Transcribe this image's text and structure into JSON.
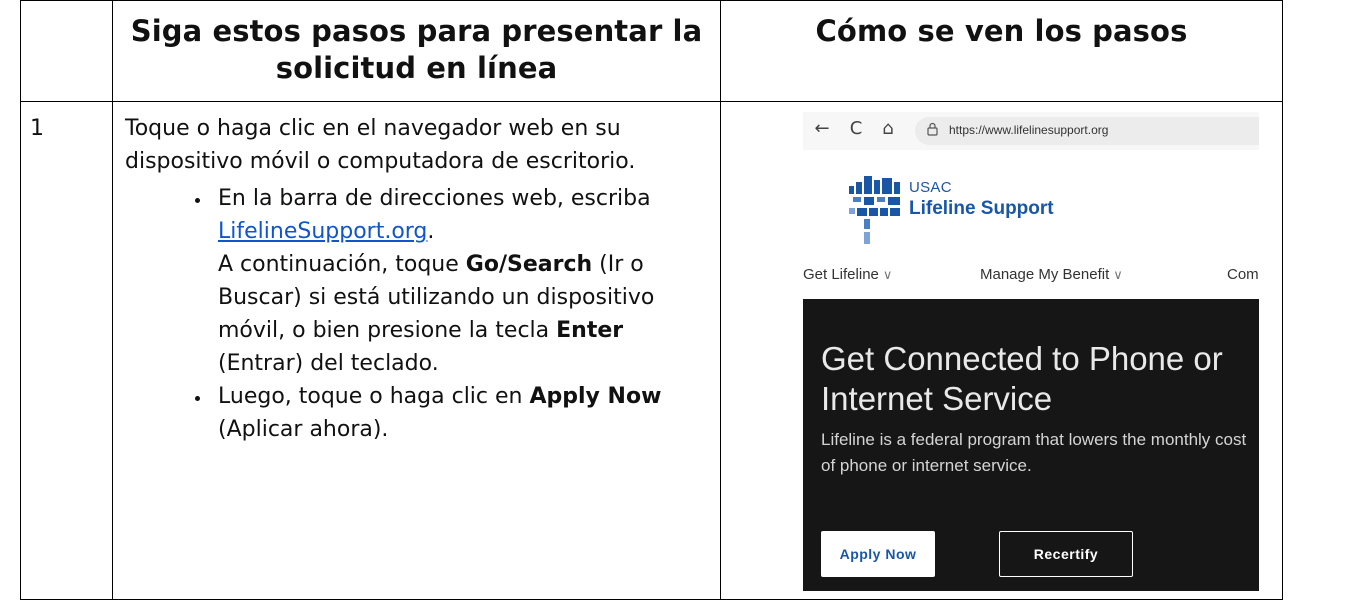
{
  "table": {
    "header_col2": "Siga estos pasos para presentar la solicitud en línea",
    "header_col3": "Cómo se ven los pasos"
  },
  "step1": {
    "number": "1",
    "intro": "Toque o haga clic en el navegador web en su dispositivo móvil o computadora de escritorio.",
    "bullet1": {
      "prefix": "En la barra de direcciones web, escriba ",
      "link": "LifelineSupport.org",
      "after_link": ".",
      "line2_pre": "A continuación, toque ",
      "go_search": "Go/Search",
      "line2_mid": " (Ir o Buscar) si está utilizando un dispositivo móvil, o bien presione la tecla ",
      "enter": "Enter",
      "line2_end": " (Entrar) del teclado."
    },
    "bullet2": {
      "pre": "Luego, toque o haga clic en ",
      "apply_now": "Apply Now",
      "post": " (Aplicar ahora)."
    }
  },
  "browser": {
    "back_icon": "←",
    "reload_icon": "C",
    "home_icon": "⌂",
    "url": "https://www.lifelinesupport.org"
  },
  "site": {
    "brand_small": "USAC",
    "brand_big": "Lifeline Support",
    "brand_color": "#1a56a6",
    "nav1": "Get Lifeline",
    "nav2": "Manage My Benefit",
    "nav3": "Com",
    "chevron": "∨",
    "hero_title": "Get Connected to Phone or Internet Service",
    "hero_desc": "Lifeline is a federal program that lowers the monthly cost of phone or internet service.",
    "apply_button": "Apply Now",
    "recertify_button": "Recertify"
  }
}
